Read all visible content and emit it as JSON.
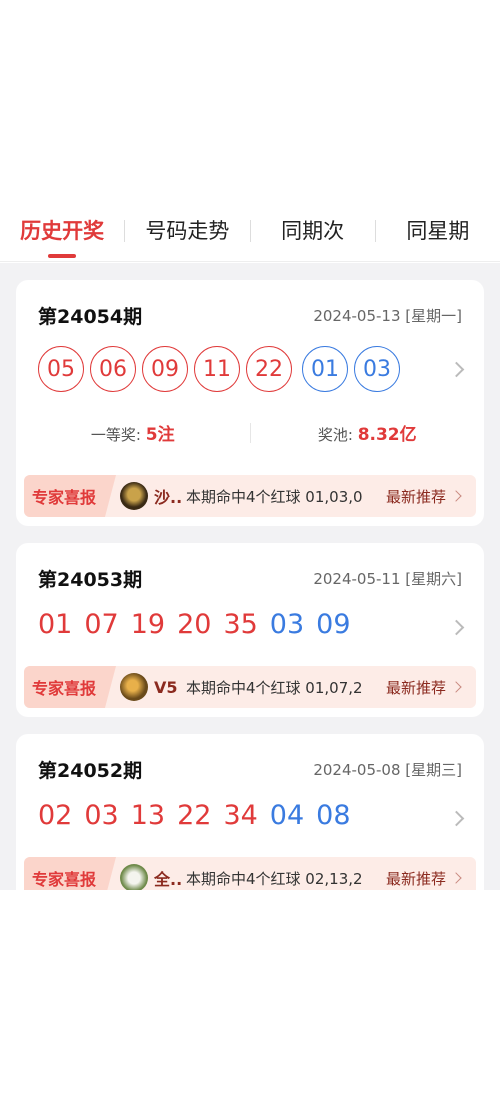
{
  "tabs": [
    "历史开奖",
    "号码走势",
    "同期次",
    "同星期"
  ],
  "draws": [
    {
      "issue": "第24054期",
      "date": "2024-05-13 [星期一]",
      "red": [
        "05",
        "06",
        "09",
        "11",
        "22"
      ],
      "blue": [
        "01",
        "03"
      ],
      "first_prize_label": "一等奖:",
      "first_prize_value": "5注",
      "pool_label": "奖池:",
      "pool_value": "8.32亿",
      "expert": {
        "tag": "专家喜报",
        "name": "沙..",
        "text": "本期命中4个红球 01,03,0",
        "more": "最新推荐"
      }
    },
    {
      "issue": "第24053期",
      "date": "2024-05-11 [星期六]",
      "red": [
        "01",
        "07",
        "19",
        "20",
        "35"
      ],
      "blue": [
        "03",
        "09"
      ],
      "expert": {
        "tag": "专家喜报",
        "name": "V5",
        "text": "本期命中4个红球 01,07,2",
        "more": "最新推荐"
      }
    },
    {
      "issue": "第24052期",
      "date": "2024-05-08 [星期三]",
      "red": [
        "02",
        "03",
        "13",
        "22",
        "34"
      ],
      "blue": [
        "04",
        "08"
      ],
      "expert": {
        "tag": "专家喜报",
        "name": "全..",
        "text": "本期命中4个红球 02,13,2",
        "more": "最新推荐"
      }
    }
  ],
  "colors": {
    "red": "#e03a3a",
    "blue": "#3a7be0",
    "background": "#f2f2f4"
  }
}
